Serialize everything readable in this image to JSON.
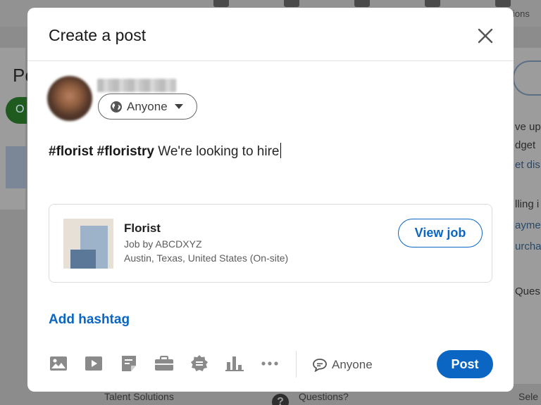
{
  "background": {
    "top_label": "ions",
    "left_title": "Po",
    "left_pill": "O",
    "right_lines": [
      "ve up",
      "dget",
      "et dis",
      "lling i",
      "ayme",
      "urcha",
      "Ques"
    ],
    "bottom_left": "Talent Solutions",
    "bottom_middle": "Questions?",
    "bottom_right": "Sele"
  },
  "modal": {
    "title": "Create a post",
    "audience_label": "Anyone",
    "post_text": {
      "hashtag1": "#florist",
      "hashtag2": "#floristry",
      "body": "We're looking to hire"
    },
    "job": {
      "title": "Florist",
      "company": "Job by ABCDXYZ",
      "location": "Austin, Texas, United States (On-site)",
      "button": "View job"
    },
    "add_hashtag": "Add hashtag",
    "toolbar": {
      "icons": [
        "image-icon",
        "video-icon",
        "document-icon",
        "briefcase-icon",
        "badge-icon",
        "poll-icon",
        "more-icon"
      ],
      "comment_audience": "Anyone",
      "post_button": "Post"
    }
  },
  "colors": {
    "accent": "#0a66c2",
    "overlay": "#8c8c8c",
    "icon_gray": "#8a8a8a"
  }
}
